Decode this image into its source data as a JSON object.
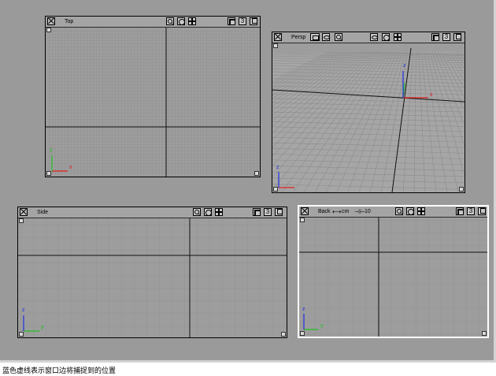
{
  "viewports": {
    "top": {
      "title": "Top",
      "layout_count": "3"
    },
    "persp": {
      "title": "Persp",
      "layout_count": "3"
    },
    "side": {
      "title": "Side",
      "layout_count": "3"
    },
    "back": {
      "title": "Back",
      "unit_label": "cm",
      "snap_value": "10",
      "layout_count": "3"
    }
  },
  "axis_labels": {
    "x": "x",
    "y": "y",
    "z": "z"
  },
  "colors": {
    "x_axis": "#e02020",
    "y_axis": "#20c020",
    "z_axis": "#2030e0",
    "active_border": "#ffffff",
    "background": "#9a9a9a"
  },
  "icons": [
    "close-icon",
    "zoom-icon",
    "fit-icon",
    "pan-icon",
    "maximize-icon",
    "restore-icon",
    "camera-icon",
    "orbit-icon",
    "snap-icon",
    "unit-arrow-icon"
  ],
  "caption": "蓝色虚线表示窗口边将捕捉到的位置"
}
